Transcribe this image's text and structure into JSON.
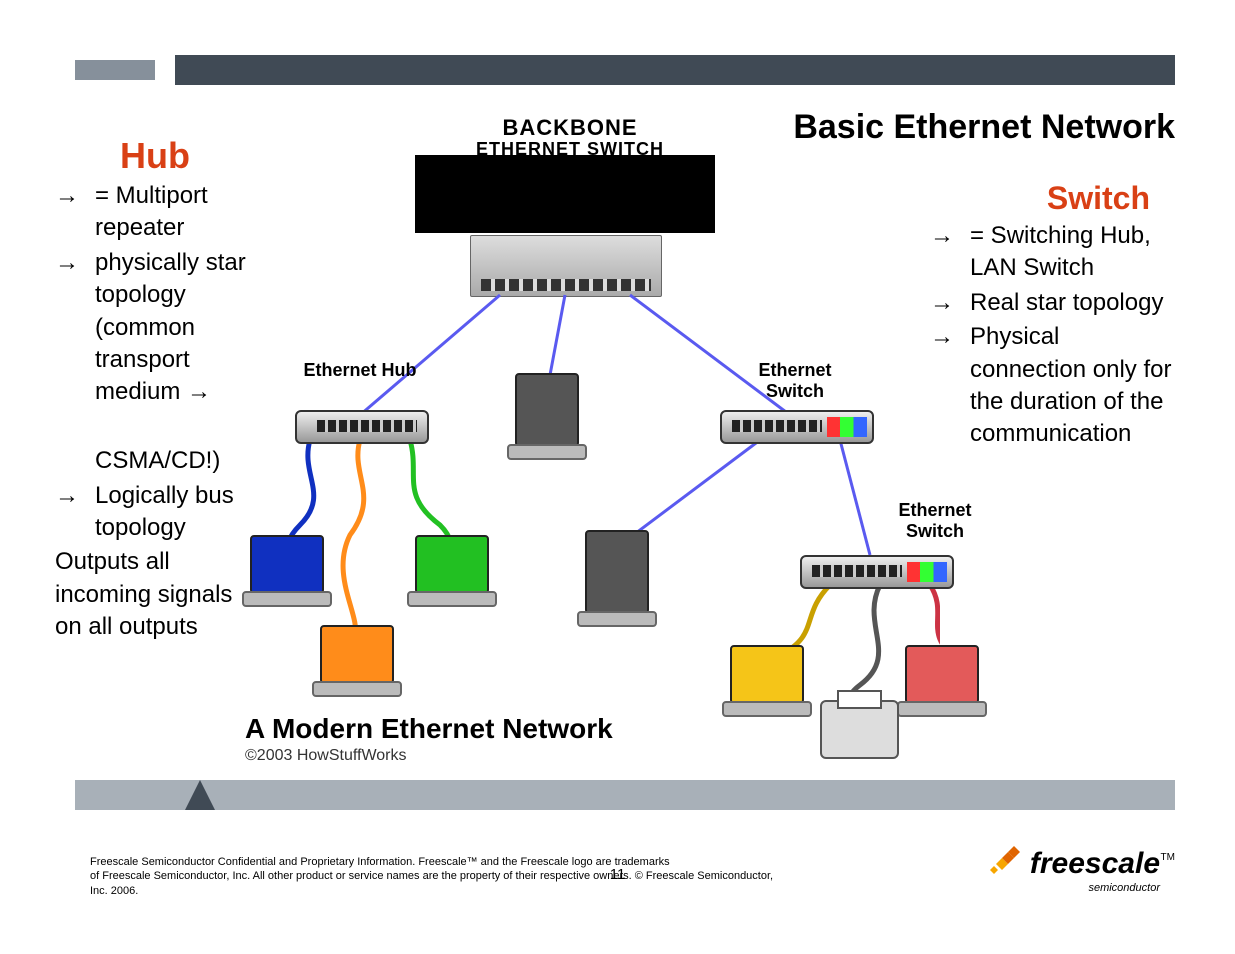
{
  "title": "Basic Ethernet Network",
  "hub": {
    "heading": "Hub",
    "bullets": [
      "= Multiport repeater",
      "physically star topology (common transport medium →",
      "",
      "CSMA/CD!)",
      "Logically bus topology"
    ],
    "tail": "Outputs all incoming signals on all outputs"
  },
  "switchCol": {
    "heading": "Switch",
    "bullets": [
      "= Switching Hub, LAN Switch",
      "Real star topology",
      "Physical connection only for the duration of the communication"
    ]
  },
  "diagram": {
    "backbone1": "BACKBONE",
    "backbone2": "ETHERNET SWITCH",
    "hubLabel": "Ethernet Hub",
    "switchLabel1": "Ethernet Switch",
    "switchLabel2": "Ethernet Switch",
    "footerTitle": "A Modern Ethernet Network",
    "footerSub": "©2003 HowStuffWorks"
  },
  "footer": {
    "line1": "Freescale Semiconductor Confidential and Proprietary Information. Freescale™ and the Freescale logo are trademarks",
    "line2": "of Freescale Semiconductor, Inc. All other product or service names are the property of their respective owners. © Freescale Semiconductor, Inc. 2006.",
    "pageNumber": "11",
    "logoText": "freescale",
    "logoSub": "semiconductor",
    "tm": "TM"
  }
}
